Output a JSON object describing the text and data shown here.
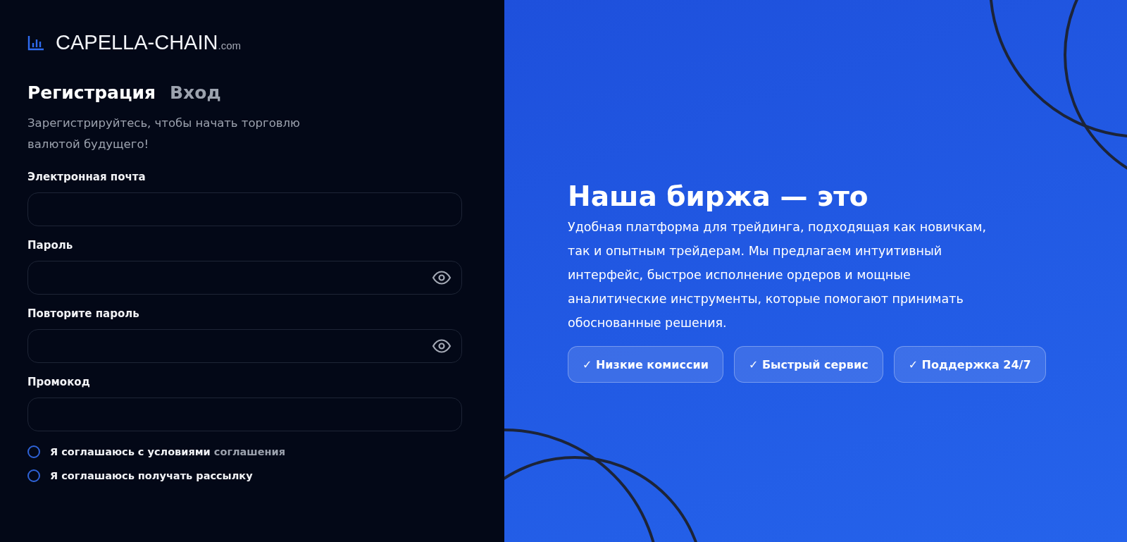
{
  "logo": {
    "name": "CAPELLA-CHAIN",
    "suffix": ".com"
  },
  "tabs": [
    {
      "label": "Регистрация",
      "selected": true
    },
    {
      "label": "Вход",
      "selected": false
    }
  ],
  "subtitle": "Зарегистрируйтесь, чтобы начать торговлю валютой будущего!",
  "fields": [
    {
      "label": "Электронная почта",
      "kind": "text"
    },
    {
      "label": "Пароль",
      "kind": "password"
    },
    {
      "label": "Повторите пароль",
      "kind": "password"
    },
    {
      "label": "Промокод",
      "kind": "text"
    }
  ],
  "agreements": [
    {
      "text": "Я соглашаюсь с условиями",
      "link": "соглашения",
      "checked": false
    },
    {
      "text": "Я соглашаюсь получать рассылку",
      "checked": false
    }
  ],
  "promo": {
    "title": "Наша биржа — это",
    "text": "Удобная платформа для трейдинга, подходящая как новичкам, так и опытным трейдерам. Мы предлагаем интуитивный интерфейс, быстрое исполнение ордеров и мощные аналитические инструменты, которые помогают принимать обоснованные решения.",
    "features": [
      "✓ Низкие комиссии",
      "✓ Быстрый сервис",
      "✓ Поддержка 24/7"
    ]
  }
}
